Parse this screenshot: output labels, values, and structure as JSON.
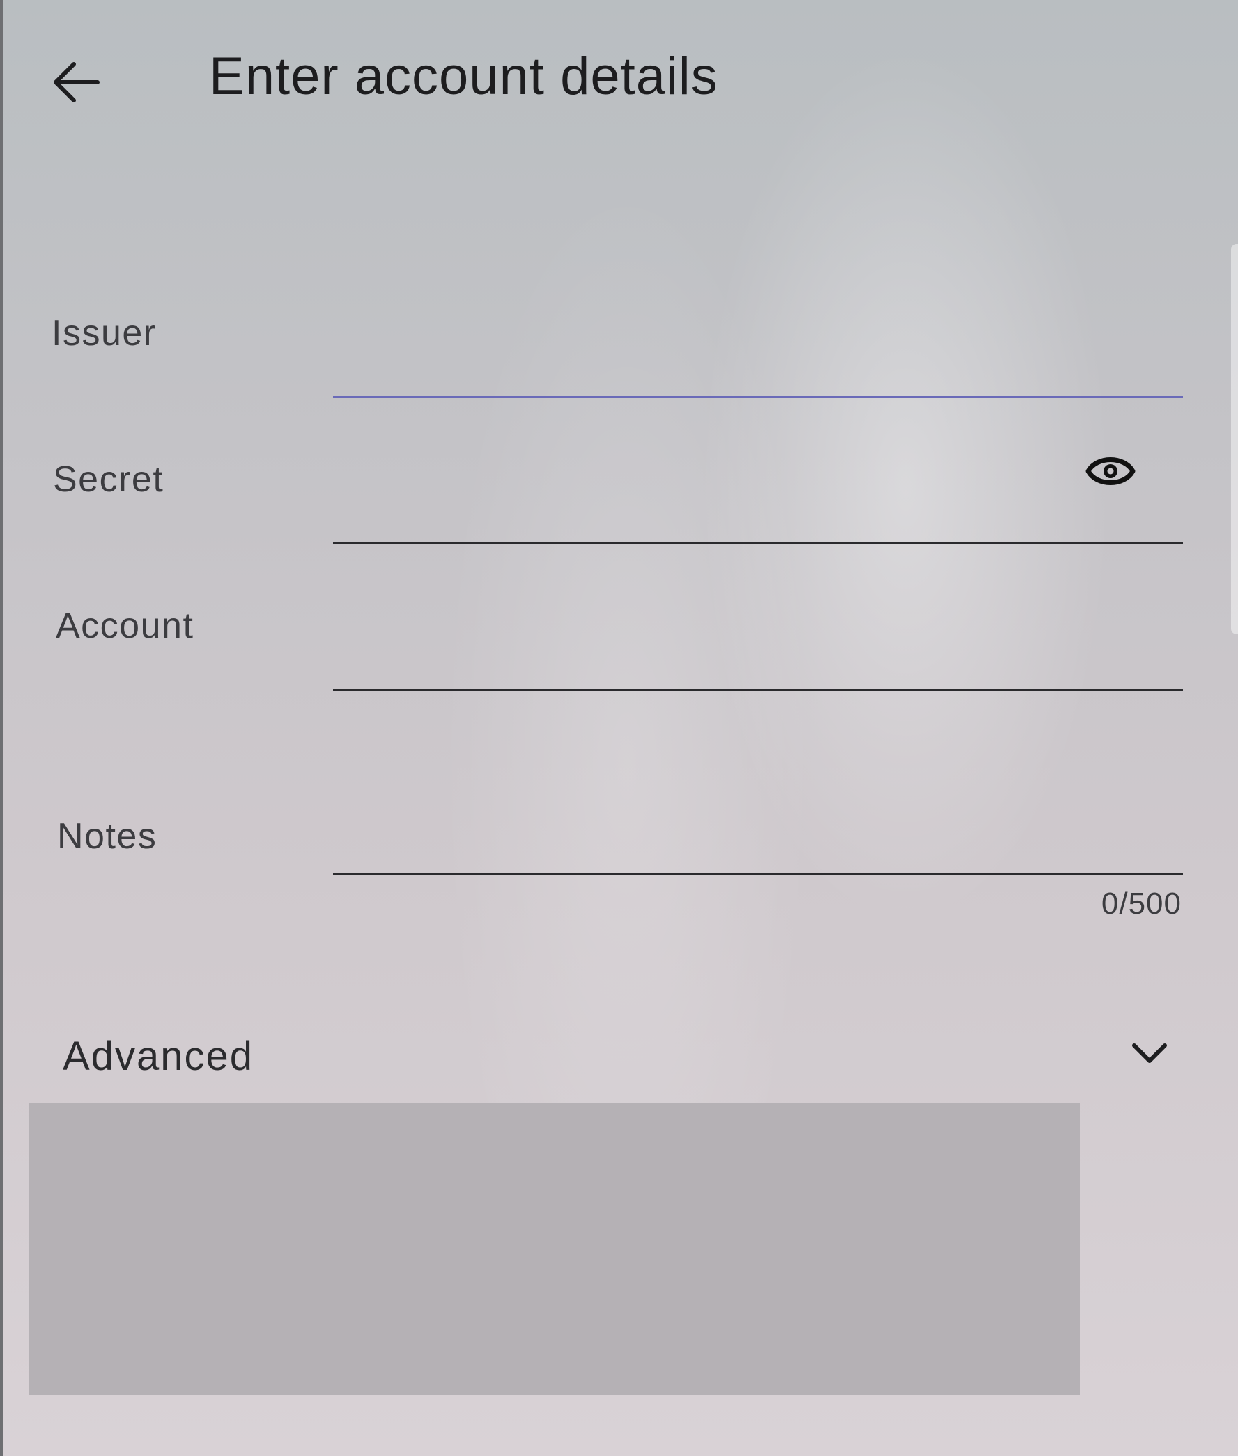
{
  "header": {
    "title": "Enter account details",
    "back_icon": "arrow-left-icon"
  },
  "form": {
    "issuer": {
      "label": "Issuer",
      "value": "",
      "focused": true
    },
    "secret": {
      "label": "Secret",
      "value": "",
      "visibility_icon": "eye-icon"
    },
    "account": {
      "label": "Account",
      "value": ""
    },
    "notes": {
      "label": "Notes",
      "value": "",
      "counter": "0/500"
    }
  },
  "advanced": {
    "label": "Advanced",
    "expand_icon": "chevron-down-icon",
    "expanded": false
  },
  "colors": {
    "focused_underline": "#6a6ab8",
    "underline": "#2a2a2d",
    "text": "#1d1d1f",
    "redacted_block": "#b5b1b5"
  }
}
